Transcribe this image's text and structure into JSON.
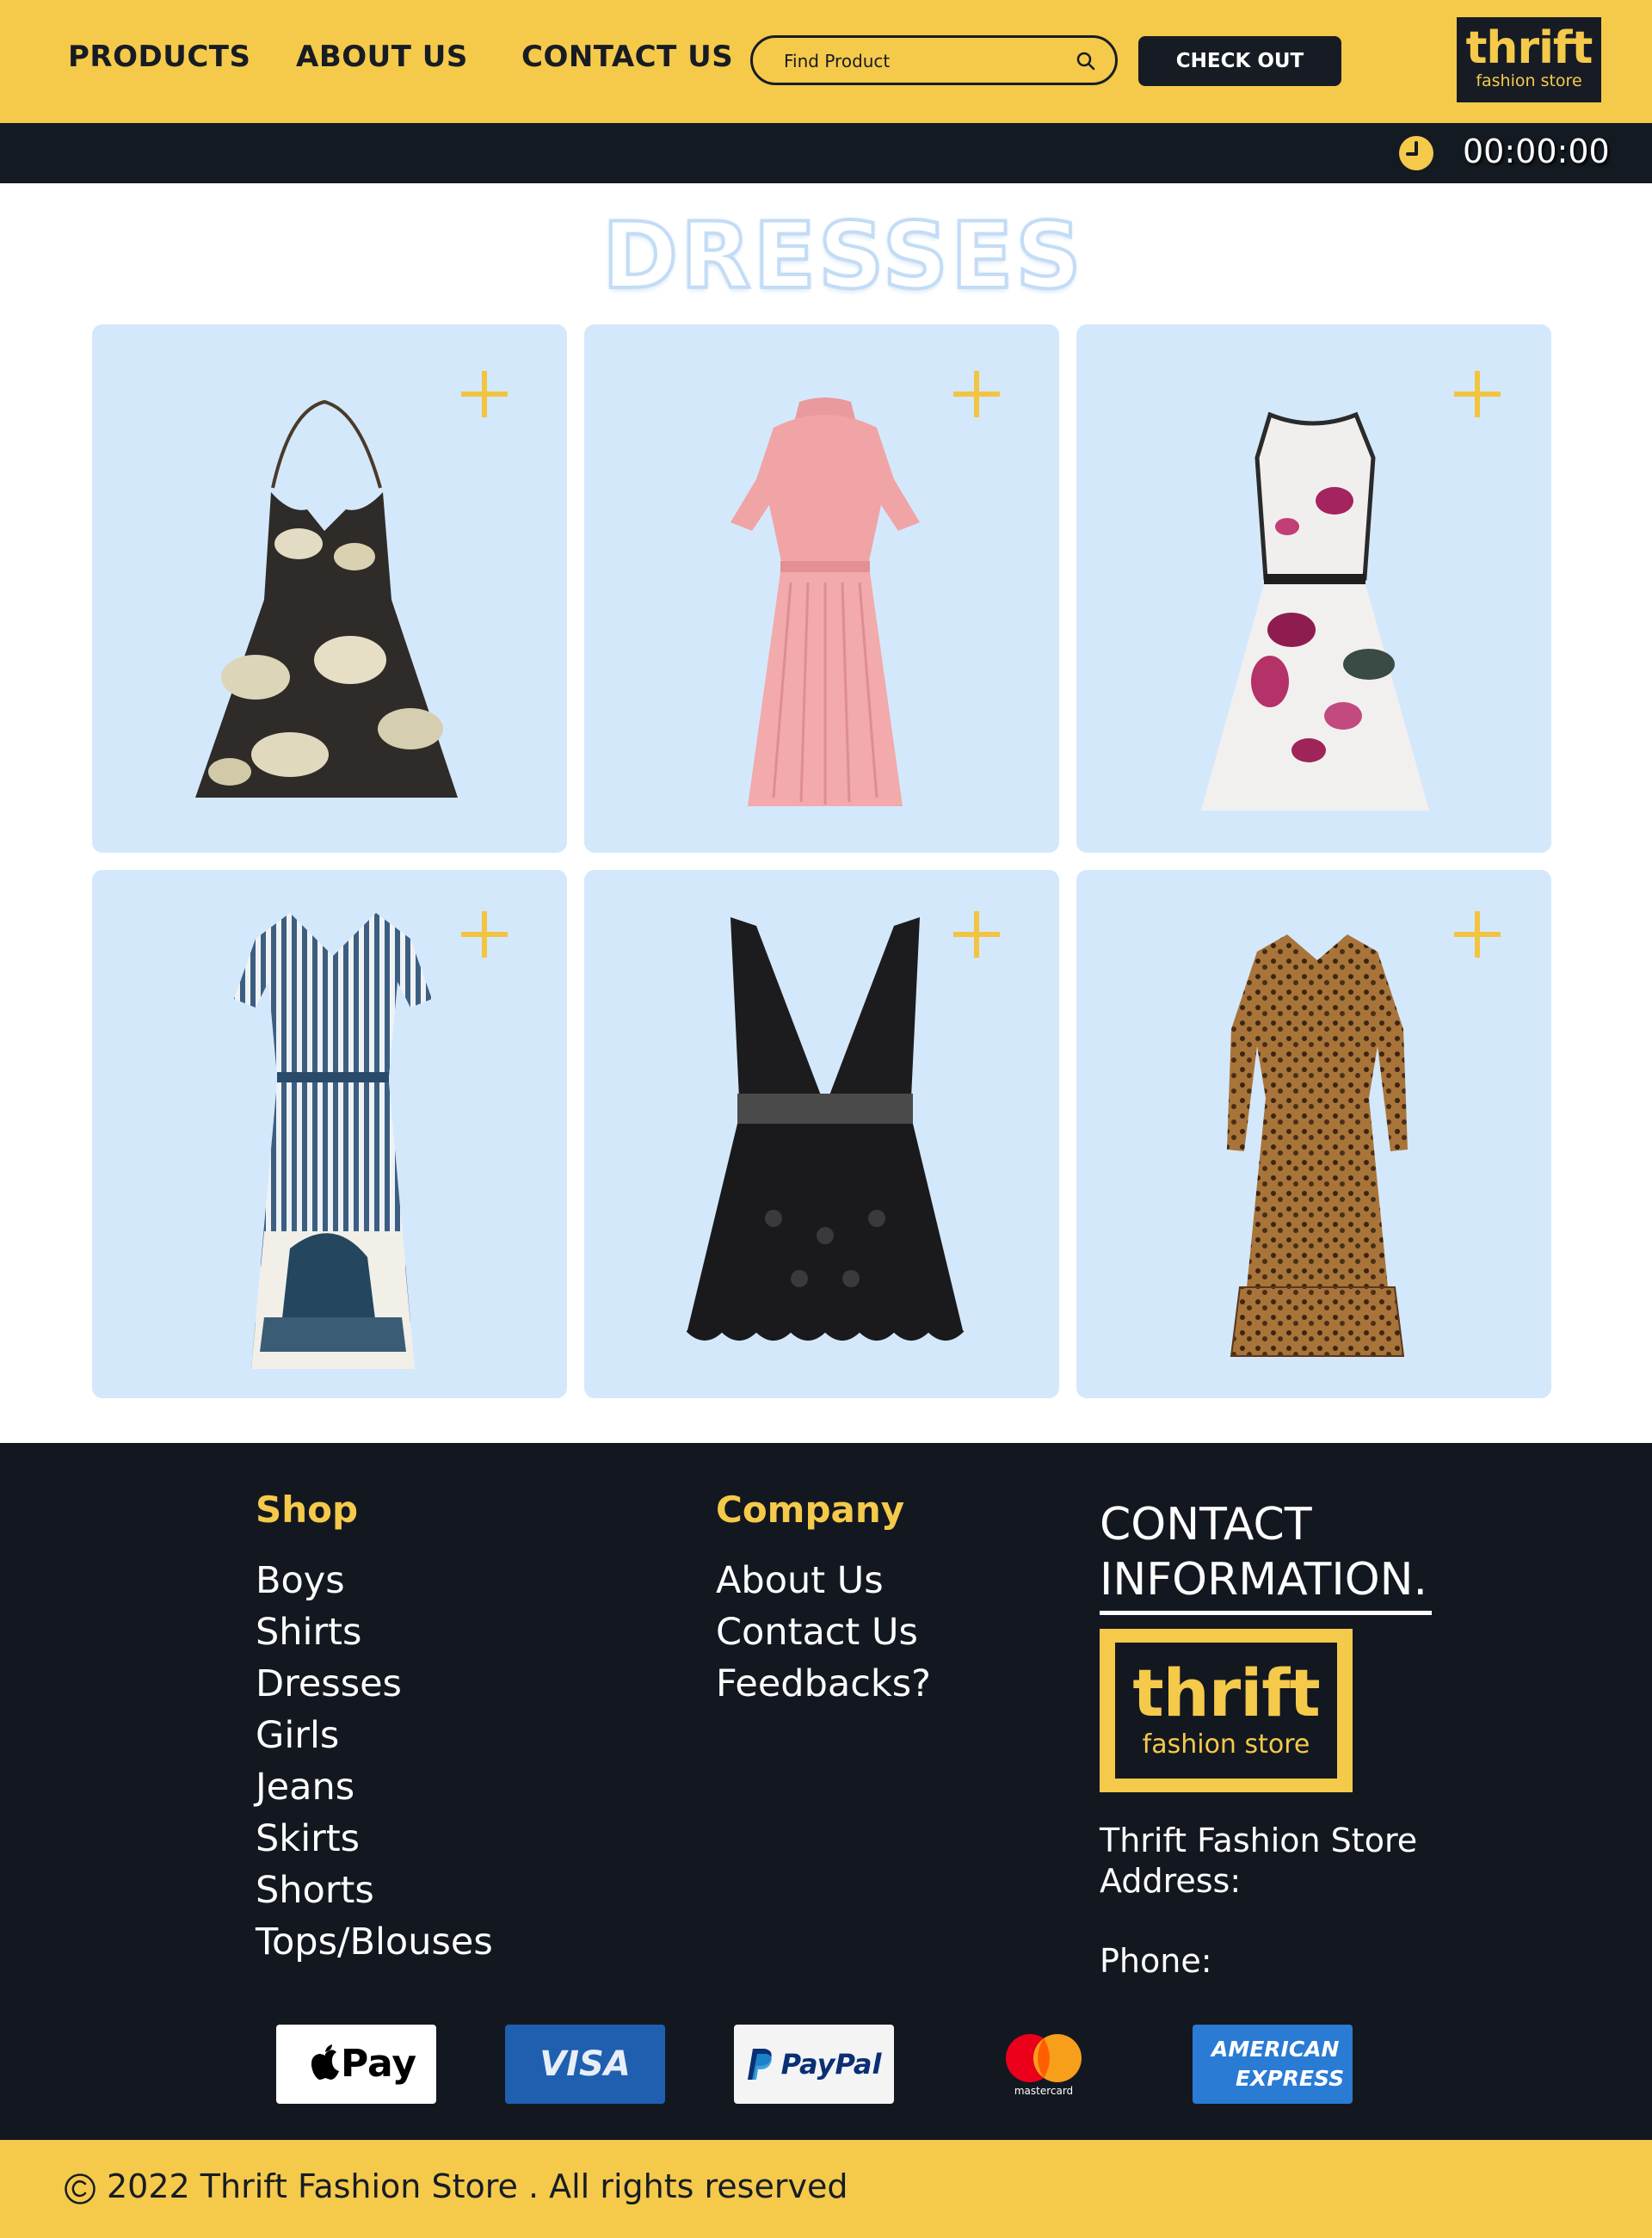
{
  "header": {
    "nav": [
      {
        "label": "PRODUCTS"
      },
      {
        "label": "ABOUT US"
      },
      {
        "label": "CONTACT US"
      }
    ],
    "search_placeholder": "Find Product",
    "checkout_label": "CHECK OUT",
    "logo": {
      "title": "thrift",
      "subtitle": "fashion store"
    },
    "accent_color": "#f5c94a",
    "dark_color": "#171c24"
  },
  "timer": {
    "icon": "clock-icon",
    "value": "00:00:00"
  },
  "section": {
    "title": "DRESSES"
  },
  "products": [
    {
      "name": "floral-halter-dress",
      "icon": "plus-icon"
    },
    {
      "name": "pink-pleated-dress",
      "icon": "plus-icon"
    },
    {
      "name": "white-floral-belted-dress",
      "icon": "plus-icon"
    },
    {
      "name": "striped-shirt-dress",
      "icon": "plus-icon"
    },
    {
      "name": "black-lace-plunge-dress",
      "icon": "plus-icon"
    },
    {
      "name": "leopard-print-long-sleeve-dress",
      "icon": "plus-icon"
    }
  ],
  "footer": {
    "shop": {
      "heading": "Shop",
      "links": [
        "Boys",
        "Shirts",
        "Dresses",
        "Girls",
        "Jeans",
        "Skirts",
        "Shorts",
        "Tops/Blouses"
      ]
    },
    "company": {
      "heading": "Company",
      "links": [
        "About Us",
        "Contact Us",
        "Feedbacks?"
      ]
    },
    "contact": {
      "title_line1": "CONTACT",
      "title_line2": "INFORMATION.",
      "logo_title": "thrift",
      "logo_subtitle": "fashion store",
      "store_name": "Thrift Fashion Store",
      "address_label": "Address:",
      "phone_label": "Phone:"
    },
    "payments": [
      {
        "name": "apple-pay",
        "label": "Pay"
      },
      {
        "name": "visa",
        "label": "VISA"
      },
      {
        "name": "paypal",
        "label": "PayPal"
      },
      {
        "name": "mastercard",
        "label": "mastercard"
      },
      {
        "name": "american-express",
        "label_line1": "AMERICAN",
        "label_line2": "EXPRESS"
      }
    ]
  },
  "copyright": {
    "icon": "copyright-icon",
    "text": "2022 Thrift Fashion Store . All rights reserved"
  }
}
